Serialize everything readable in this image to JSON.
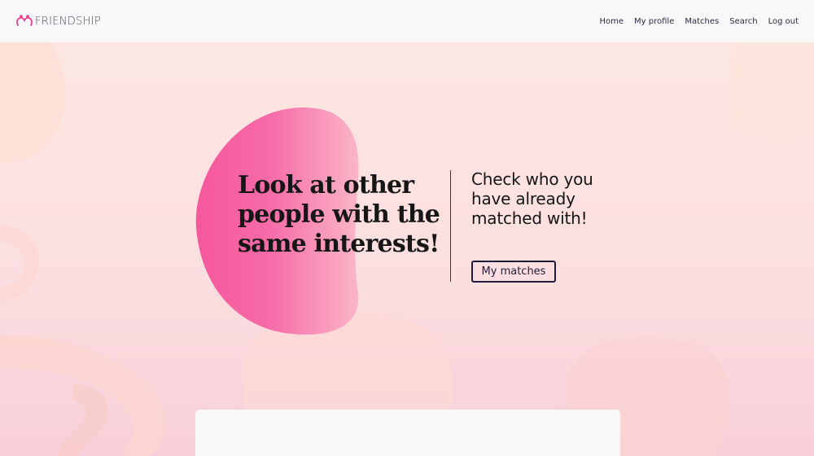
{
  "navbar": {
    "brand_text": "FRIENDSHIP",
    "brand_icon": "heart-hands-icon",
    "links": [
      {
        "label": "Home"
      },
      {
        "label": "My profile"
      },
      {
        "label": "Matches"
      },
      {
        "label": "Search"
      },
      {
        "label": "Log out"
      }
    ]
  },
  "hero": {
    "headline": "Look at other people with the same interests!",
    "side_text": "Check who you have already matched with!",
    "cta_label": "My matches"
  },
  "colors": {
    "accent": "#f75fa2",
    "button_border": "#1f1b3a",
    "navbar_bg": "#f8f8f8"
  }
}
